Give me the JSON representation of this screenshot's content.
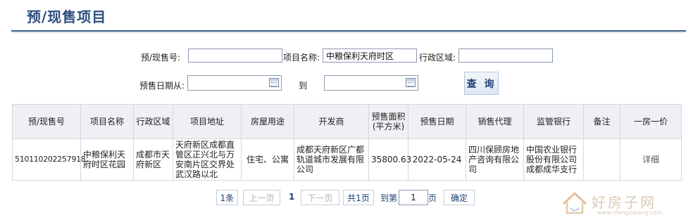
{
  "header": {
    "title": "预/现售项目"
  },
  "search": {
    "presale_no_label": "预/现售号:",
    "presale_no_value": "",
    "project_name_label": "项目名称:",
    "project_name_value": "中粮保利天府时区",
    "district_label": "行政区域:",
    "district_value": "",
    "date_from_label": "预售日期从:",
    "date_from_value": "",
    "date_to_label": "到",
    "date_to_value": "",
    "query_button": "查 询"
  },
  "table": {
    "headers": [
      "预/现售号",
      "项目名称",
      "行政区域",
      "项目地址",
      "房屋用途",
      "开发商",
      "预售面积(平方米)",
      "预售日期",
      "销售代理",
      "监管银行",
      "备注",
      "一房一价"
    ],
    "rows": [
      {
        "presale_no": "510110202257918",
        "project_name": "中粮保利天府时区花园",
        "district": "成都市天府新区",
        "address": "天府新区成都直管区正兴北与万安南片区交界处武汉路以北",
        "usage": "住宅、公寓",
        "developer": "成都天府新区广都轨道城市发展有限公司",
        "area": "35800.63",
        "date": "2022-05-24",
        "agent": "四川保顾房地产咨询有限公司",
        "bank": "中国农业银行股份有限公司成都成华支行",
        "remark": "",
        "price_link": "详细"
      }
    ]
  },
  "pagination": {
    "total": "1条",
    "prev": "上一页",
    "current": "1",
    "next": "下一页",
    "pages": "共1页",
    "goto_label": "到第",
    "goto_value": "1",
    "page_unit": "页",
    "confirm": "确定"
  },
  "watermark": {
    "text": "好房子网",
    "url": "www.hfangziwang.com"
  },
  "colors": {
    "accent": "#2c4e7e",
    "rule": "#355a8c",
    "header_bg": "#eef0f3"
  }
}
